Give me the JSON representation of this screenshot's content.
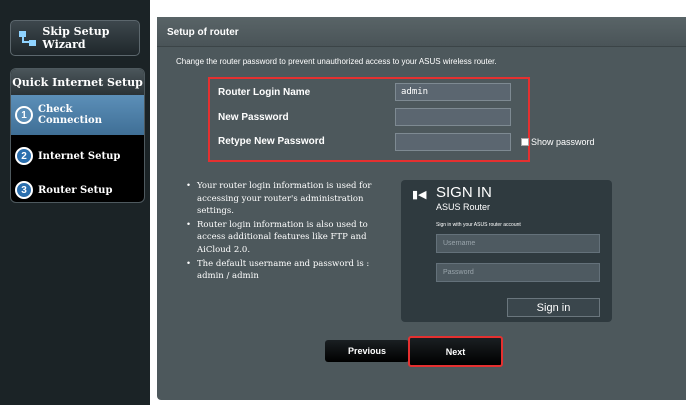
{
  "sidebar": {
    "skip_label": "Skip Setup Wizard",
    "panel_title": "Quick Internet Setup",
    "steps": [
      {
        "num": "1",
        "label_line1": "Check",
        "label_line2": "Connection",
        "active": true
      },
      {
        "num": "2",
        "label_line1": "Internet Setup",
        "active": false
      },
      {
        "num": "3",
        "label_line1": "Router Setup",
        "active": false
      }
    ]
  },
  "main": {
    "title": "Setup of router",
    "description": "Change the router password to prevent unauthorized access to your ASUS wireless router.",
    "fields": {
      "login_label": "Router Login Name",
      "login_value": "admin",
      "new_pw_label": "New Password",
      "new_pw_value": "",
      "retype_label": "Retype New Password",
      "retype_value": ""
    },
    "show_password_label": "Show password",
    "info": [
      "Your router login information is used for accessing your router's administration settings.",
      "Router login information is also used to access additional features like FTP and AiCloud 2.0.",
      "The default username and password is : admin / admin"
    ],
    "signin": {
      "title": "SIGN IN",
      "subtitle": "ASUS Router",
      "hint": "Sign in with your ASUS router account",
      "username_placeholder": "Username",
      "password_placeholder": "Password",
      "button": "Sign in"
    },
    "previous_label": "Previous",
    "next_label": "Next"
  },
  "colors": {
    "highlight": "#e53030",
    "accent": "#5c8fb8"
  }
}
